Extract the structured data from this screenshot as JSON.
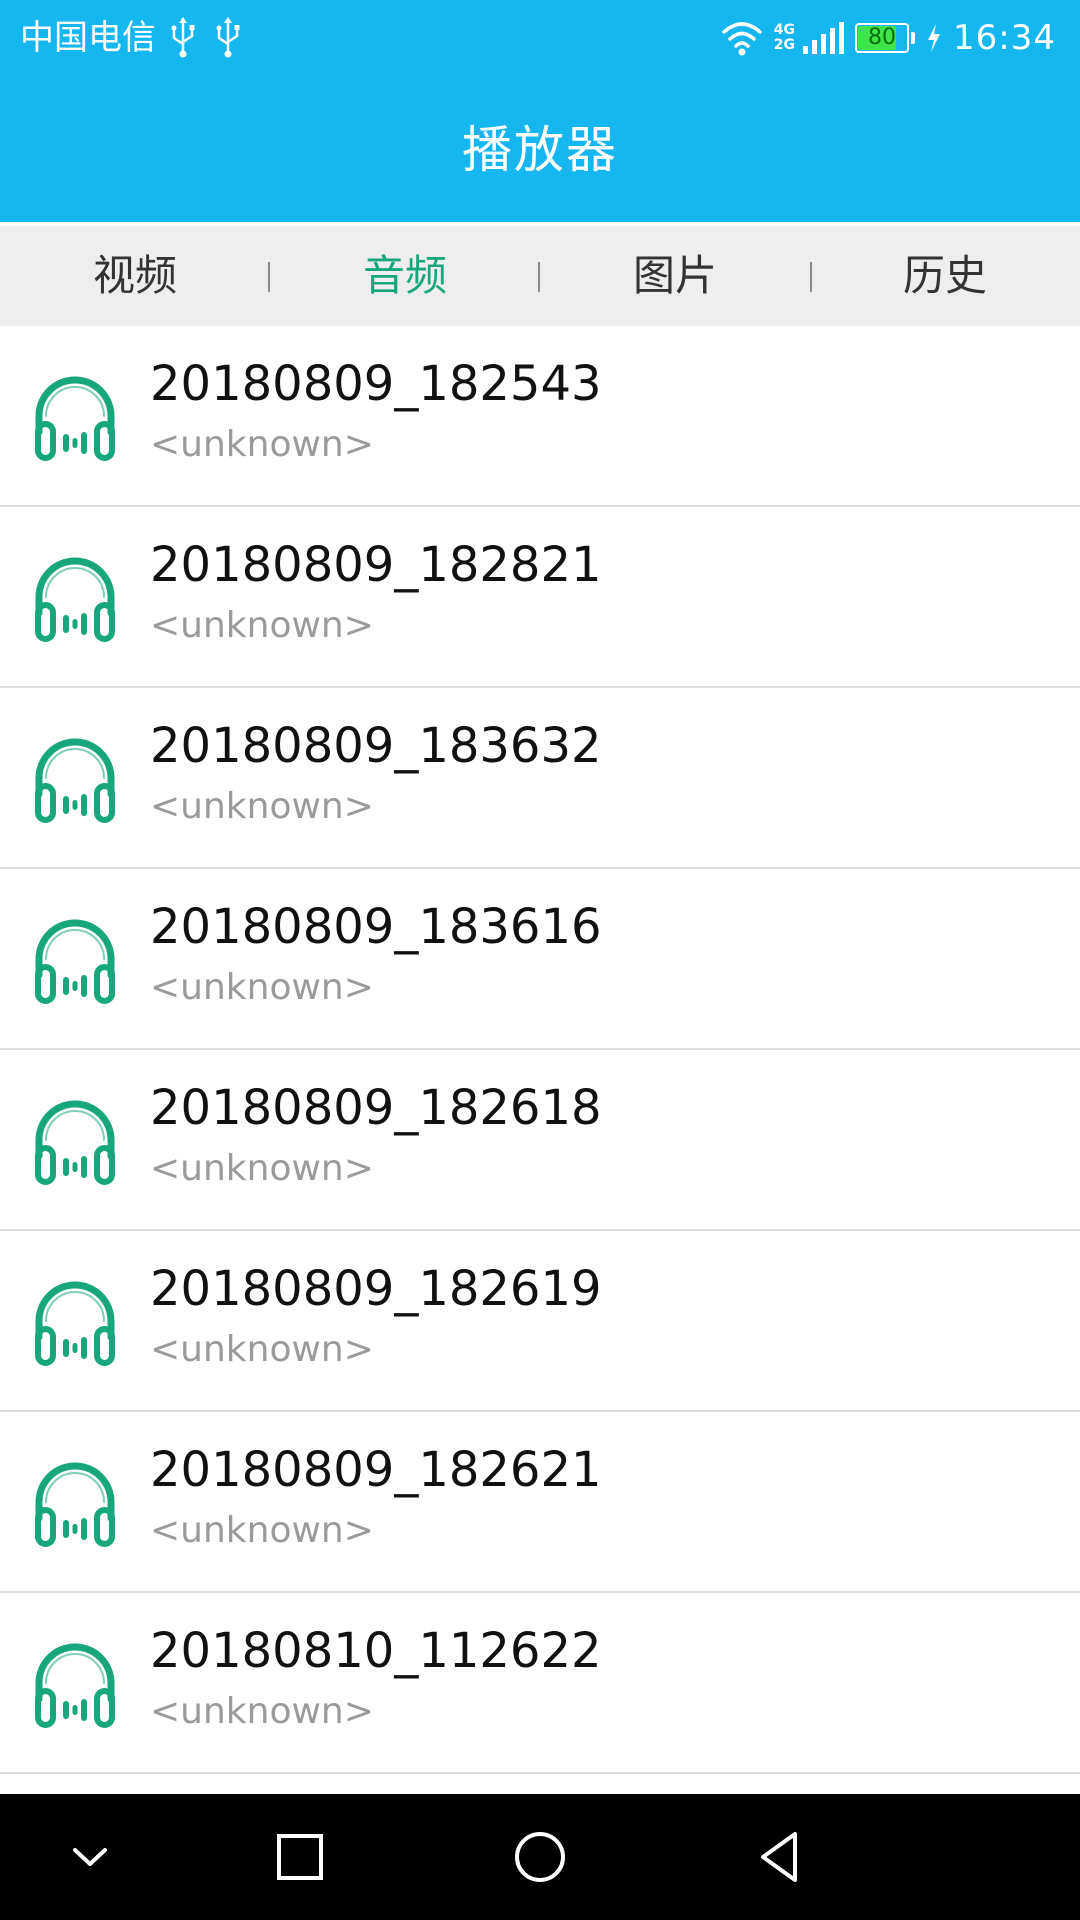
{
  "status_bar": {
    "carrier": "中国电信",
    "net_top": "4G",
    "net_bottom": "2G",
    "battery": "80",
    "battery_percent": 80,
    "time": "16:34"
  },
  "header": {
    "title": "播放器"
  },
  "tabs": [
    {
      "label": "视频",
      "active": false
    },
    {
      "label": "音频",
      "active": true
    },
    {
      "label": "图片",
      "active": false
    },
    {
      "label": "历史",
      "active": false
    }
  ],
  "list": [
    {
      "title": "20180809_182543",
      "subtitle": "<unknown>"
    },
    {
      "title": "20180809_182821",
      "subtitle": "<unknown>"
    },
    {
      "title": "20180809_183632",
      "subtitle": "<unknown>"
    },
    {
      "title": "20180809_183616",
      "subtitle": "<unknown>"
    },
    {
      "title": "20180809_182618",
      "subtitle": "<unknown>"
    },
    {
      "title": "20180809_182619",
      "subtitle": "<unknown>"
    },
    {
      "title": "20180809_182621",
      "subtitle": "<unknown>"
    },
    {
      "title": "20180810_112622",
      "subtitle": "<unknown>"
    }
  ],
  "icons": {
    "list_item": "headphones-icon",
    "nav": [
      "chevron-down-icon",
      "square-icon",
      "circle-icon",
      "triangle-back-icon"
    ]
  },
  "colors": {
    "header": "#16b6f0",
    "accent": "#18a67d",
    "tab_bar": "#eeeeee",
    "nav_bar": "#000000"
  }
}
